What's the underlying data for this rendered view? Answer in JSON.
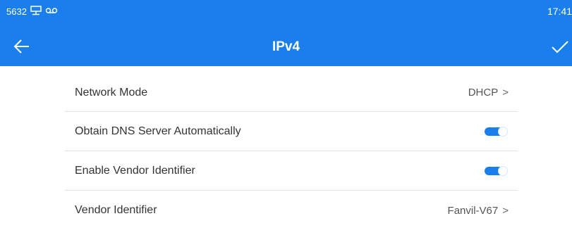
{
  "status_bar": {
    "left_text": "5632",
    "icons": [
      "network-icon",
      "voicemail-icon"
    ],
    "time": "17:41"
  },
  "header": {
    "title": "IPv4",
    "back_icon": "arrow-left-icon",
    "confirm_icon": "checkmark-icon"
  },
  "settings": [
    {
      "label": "Network Mode",
      "type": "select",
      "value": "DHCP",
      "chevron": ">"
    },
    {
      "label": "Obtain DNS Server Automatically",
      "type": "toggle",
      "checked": true
    },
    {
      "label": "Enable Vendor Identifier",
      "type": "toggle",
      "checked": true
    },
    {
      "label": "Vendor Identifier",
      "type": "select",
      "value": "Fanvil-V67",
      "chevron": ">"
    }
  ],
  "colors": {
    "accent": "#1a7fec",
    "divider": "#e4e4e4",
    "text": "#333333"
  }
}
